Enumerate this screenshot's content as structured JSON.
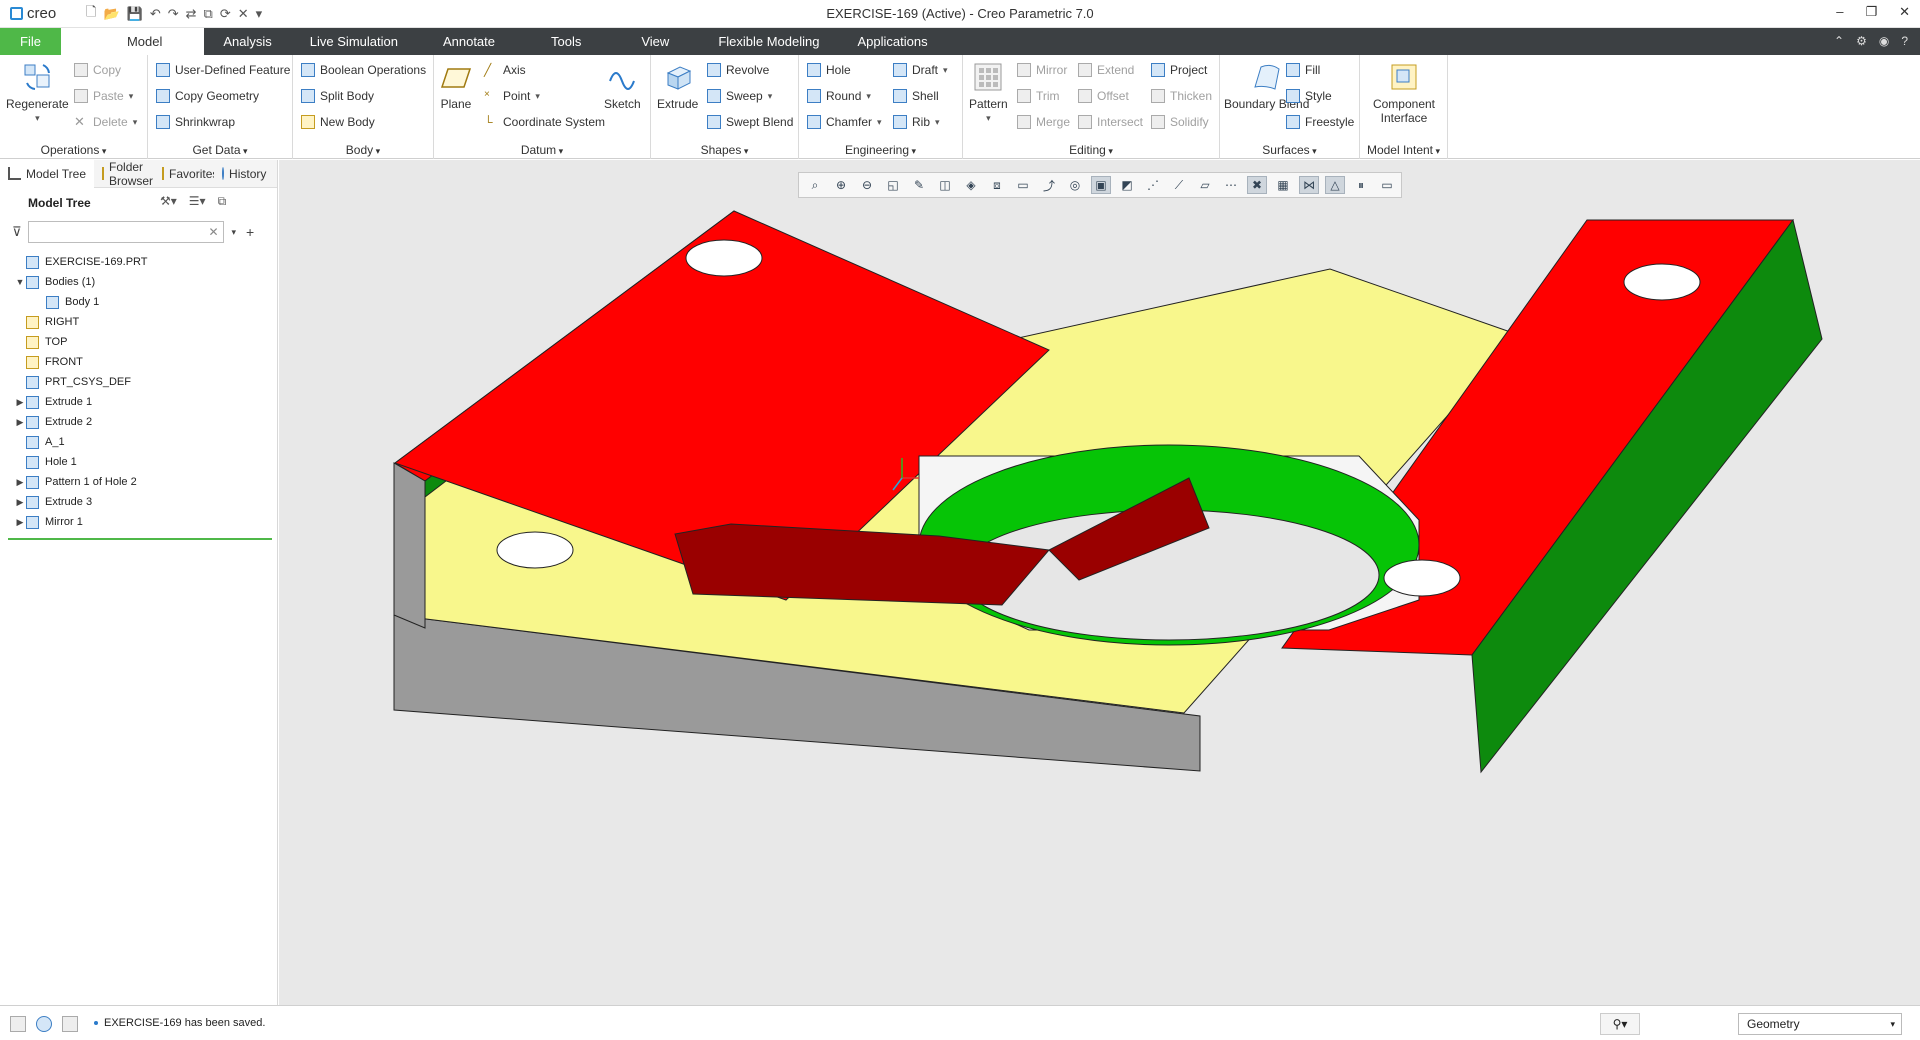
{
  "app": {
    "logo_text": "creo",
    "window_title": "EXERCISE-169 (Active) - Creo Parametric 7.0",
    "window_controls": [
      "–",
      "❐",
      "✕"
    ]
  },
  "quick_access": [
    "🗋",
    "📂",
    "💾",
    "↶",
    "↷",
    "⇄",
    "⧉",
    "⟳",
    "✕",
    "▾"
  ],
  "menu": {
    "file": "File",
    "tabs": [
      "Model",
      "Analysis",
      "Live Simulation",
      "Annotate",
      "Tools",
      "View",
      "Flexible Modeling",
      "Applications"
    ],
    "active": "Model",
    "right_icons": [
      "⌃",
      "⚙",
      "◉",
      "?"
    ]
  },
  "ribbon": {
    "operations": {
      "label": "Operations",
      "regenerate": "Regenerate",
      "copy": "Copy",
      "paste": "Paste",
      "delete": "Delete"
    },
    "get_data": {
      "label": "Get Data",
      "udf": "User-Defined Feature",
      "copy_geometry": "Copy Geometry",
      "shrinkwrap": "Shrinkwrap"
    },
    "body": {
      "label": "Body",
      "boolean": "Boolean Operations",
      "split": "Split Body",
      "new": "New Body"
    },
    "datum": {
      "label": "Datum",
      "plane": "Plane",
      "axis": "Axis",
      "point": "Point",
      "csys": "Coordinate System",
      "sketch": "Sketch"
    },
    "shapes": {
      "label": "Shapes",
      "extrude": "Extrude",
      "revolve": "Revolve",
      "sweep": "Sweep",
      "swept_blend": "Swept Blend"
    },
    "engineering": {
      "label": "Engineering",
      "hole": "Hole",
      "round": "Round",
      "chamfer": "Chamfer",
      "draft": "Draft",
      "shell": "Shell",
      "rib": "Rib"
    },
    "editing": {
      "label": "Editing",
      "pattern": "Pattern",
      "mirror": "Mirror",
      "trim": "Trim",
      "merge": "Merge",
      "extend": "Extend",
      "offset": "Offset",
      "intersect": "Intersect",
      "project": "Project",
      "thicken": "Thicken",
      "solidify": "Solidify"
    },
    "surfaces": {
      "label": "Surfaces",
      "boundary_blend": "Boundary Blend",
      "fill": "Fill",
      "style": "Style",
      "freestyle": "Freestyle"
    },
    "model_intent": {
      "label": "Model Intent",
      "component_interface": "Component Interface"
    }
  },
  "left_tabs": [
    "Model Tree",
    "Folder Browser",
    "Favorites",
    "History"
  ],
  "tree": {
    "header": "Model Tree",
    "search_placeholder": "",
    "nodes": [
      {
        "label": "EXERCISE-169.PRT",
        "level": 0,
        "arrow": ""
      },
      {
        "label": "Bodies (1)",
        "level": 0,
        "arrow": "▼"
      },
      {
        "label": "Body 1",
        "level": 1,
        "arrow": ""
      },
      {
        "label": "RIGHT",
        "level": 0,
        "arrow": ""
      },
      {
        "label": "TOP",
        "level": 0,
        "arrow": ""
      },
      {
        "label": "FRONT",
        "level": 0,
        "arrow": ""
      },
      {
        "label": "PRT_CSYS_DEF",
        "level": 0,
        "arrow": ""
      },
      {
        "label": "Extrude 1",
        "level": 0,
        "arrow": "▶"
      },
      {
        "label": "Extrude 2",
        "level": 0,
        "arrow": "▶"
      },
      {
        "label": "A_1",
        "level": 0,
        "arrow": ""
      },
      {
        "label": "Hole 1",
        "level": 0,
        "arrow": ""
      },
      {
        "label": "Pattern 1 of Hole 2",
        "level": 0,
        "arrow": "▶"
      },
      {
        "label": "Extrude 3",
        "level": 0,
        "arrow": "▶"
      },
      {
        "label": "Mirror 1",
        "level": 0,
        "arrow": "▶"
      }
    ]
  },
  "view_toolbar": [
    "⌕",
    "⊕",
    "⊖",
    "◱",
    "✎",
    "◫",
    "◈",
    "⧈",
    "▭",
    "⤴",
    "◎",
    "▣",
    "◩",
    "⋰",
    "⟋",
    "▱",
    "⋯",
    "✖",
    "▦",
    "⋈",
    "△",
    "⏸",
    "▭"
  ],
  "status": {
    "message": "EXERCISE-169 has been saved.",
    "find_icon": "⚲▾",
    "filter_value": "Geometry"
  },
  "colors": {
    "file_tab": "#4fb848",
    "menu_bg": "#3c4043",
    "base_plate_top": "#f8f78c",
    "base_plate_side": "#999999",
    "rail_top": "#ff0000",
    "rail_side": "#0d8a0d",
    "boss_top": "#f5f5f5",
    "boss_wall": "#06c406",
    "boss_side": "#9a0000",
    "viewport_bg": "#e8e8e8"
  }
}
